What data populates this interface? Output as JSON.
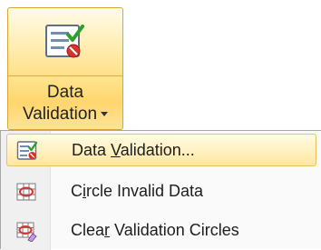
{
  "ribbon_button": {
    "label_line1": "Data",
    "label_line2": "Validation",
    "icon": "data-validation-icon"
  },
  "menu": {
    "items": [
      {
        "label_before": "Data ",
        "label_underline": "V",
        "label_after": "alidation...",
        "icon": "data-validation-icon",
        "highlighted": true
      },
      {
        "label_before": "C",
        "label_underline": "i",
        "label_after": "rcle Invalid Data",
        "icon": "circle-invalid-data-icon",
        "highlighted": false
      },
      {
        "label_before": "Clea",
        "label_underline": "r",
        "label_after": " Validation Circles",
        "icon": "clear-validation-circles-icon",
        "highlighted": false
      }
    ]
  },
  "colors": {
    "hover_border": "#d9a632",
    "hover_fill": "#ffe08a",
    "check_green": "#2e9e2e",
    "stop_red": "#d9322b"
  }
}
